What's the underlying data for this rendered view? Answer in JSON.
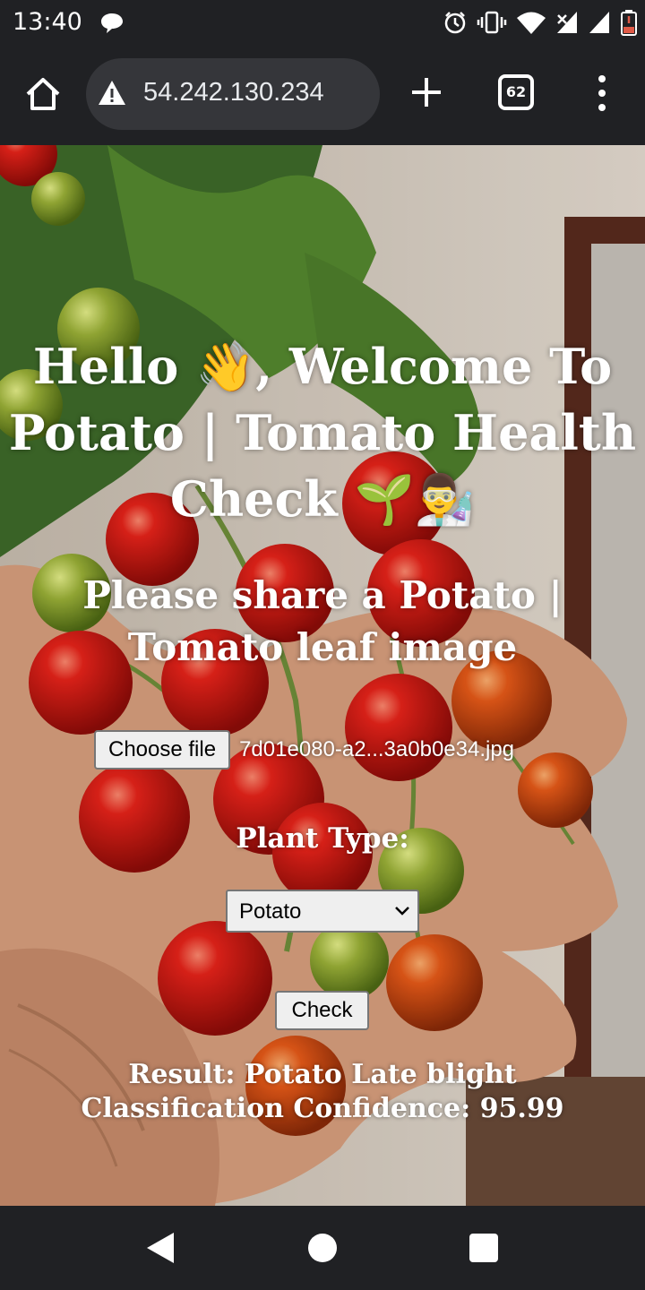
{
  "status_bar": {
    "time": "13:40",
    "icons": [
      "messages-icon",
      "alarm-icon",
      "vibrate-icon",
      "wifi-icon",
      "no-sim-icon",
      "signal-icon",
      "battery-low-icon"
    ]
  },
  "browser": {
    "url": "54.242.130.234",
    "tab_count": "62",
    "security": "not-secure-warning-icon"
  },
  "page": {
    "heading": "Hello 👋, Welcome To Potato | Tomato Health Check 🌱👨‍🔬",
    "subheading": "Please share a Potato | Tomato leaf image",
    "file_input": {
      "button_label": "Choose file",
      "file_name": "7d01e080-a2...3a0b0e34.jpg"
    },
    "plant_type_label": "Plant Type:",
    "plant_select": {
      "selected": "Potato"
    },
    "check_button": "Check",
    "result": "Result: Potato Late blight",
    "confidence": "Classification Confidence: 95.99"
  },
  "colors": {
    "system_bar": "#202124",
    "url_box": "#35363a",
    "form_control_bg": "#efefef",
    "form_control_border": "#767676",
    "text_on_image": "#ffffff"
  }
}
